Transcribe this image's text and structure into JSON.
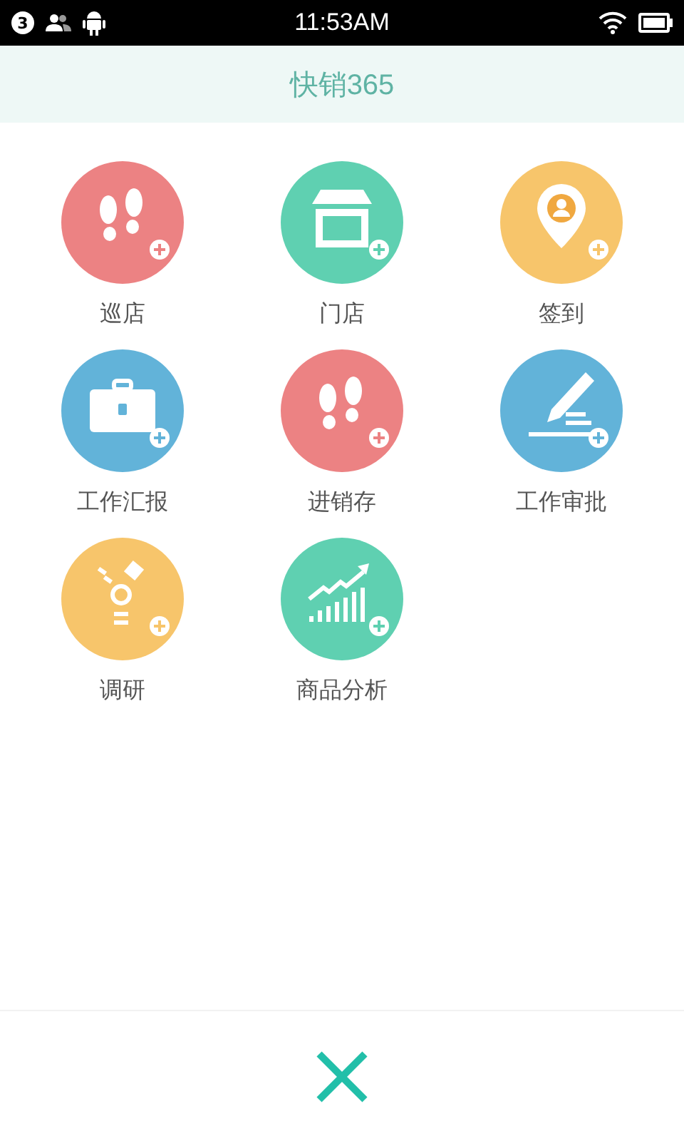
{
  "status_bar": {
    "notification_count": "3",
    "time": "11:53AM"
  },
  "app_bar": {
    "title": "快销365"
  },
  "menu": [
    {
      "label": "巡店",
      "color": "#ec8283",
      "kind": "footprints"
    },
    {
      "label": "门店",
      "color": "#5fd0b1",
      "kind": "shop"
    },
    {
      "label": "签到",
      "color": "#f7c56b",
      "kind": "pin"
    },
    {
      "label": "工作汇报",
      "color": "#62b3d9",
      "kind": "briefcase"
    },
    {
      "label": "进销存",
      "color": "#ec8283",
      "kind": "footprints"
    },
    {
      "label": "工作审批",
      "color": "#62b3d9",
      "kind": "pencil"
    },
    {
      "label": "调研",
      "color": "#f7c56b",
      "kind": "survey"
    },
    {
      "label": "商品分析",
      "color": "#5fd0b1",
      "kind": "chart"
    }
  ]
}
